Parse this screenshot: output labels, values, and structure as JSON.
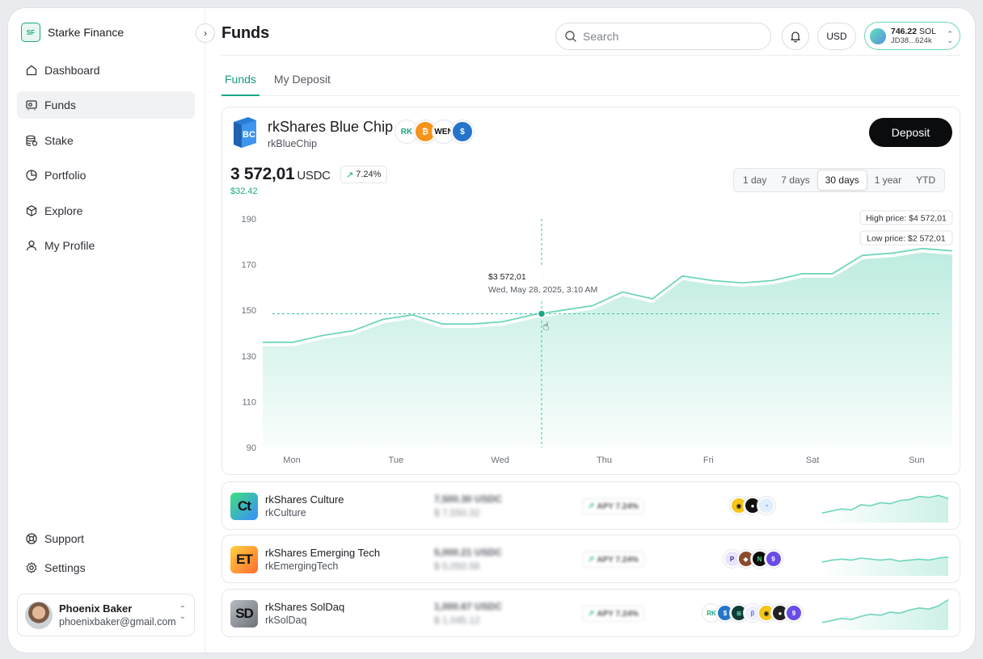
{
  "brand": {
    "name": "Starke Finance",
    "logo_text": "SF"
  },
  "sidebar": {
    "items": [
      {
        "label": "Dashboard",
        "icon": "home-icon"
      },
      {
        "label": "Funds",
        "icon": "funds-icon",
        "active": true
      },
      {
        "label": "Stake",
        "icon": "stake-icon"
      },
      {
        "label": "Portfolio",
        "icon": "portfolio-icon"
      },
      {
        "label": "Explore",
        "icon": "explore-icon"
      },
      {
        "label": "My Profile",
        "icon": "user-icon"
      }
    ],
    "bottom": [
      {
        "label": "Support",
        "icon": "support-icon"
      },
      {
        "label": "Settings",
        "icon": "gear-icon"
      }
    ],
    "user": {
      "name": "Phoenix Baker",
      "email": "phoenixbaker@gmail.com"
    }
  },
  "header": {
    "title": "Funds",
    "search_placeholder": "Search",
    "currency": "USD",
    "wallet": {
      "balance": "746.22",
      "unit": "SOL",
      "address": "JD38...624k"
    }
  },
  "tabs": [
    {
      "label": "Funds",
      "active": true
    },
    {
      "label": "My Deposit"
    }
  ],
  "fund": {
    "name": "rkShares Blue Chip",
    "ticker": "rkBlueChip",
    "logo_text": "BC",
    "deposit_label": "Deposit",
    "price": "3 572,01",
    "price_unit": "USDC",
    "change_pct": "7.24%",
    "change_abs": "$32.42",
    "tokens": [
      {
        "label": "RK",
        "bg": "#ffffff",
        "fg": "#1aa886"
      },
      {
        "label": "₿",
        "bg": "#f7931a",
        "fg": "#ffffff"
      },
      {
        "label": "WEN",
        "bg": "#ffffff",
        "fg": "#111111"
      },
      {
        "label": "$",
        "bg": "#2775ca",
        "fg": "#ffffff"
      }
    ],
    "ranges": [
      {
        "label": "1 day"
      },
      {
        "label": "7 days"
      },
      {
        "label": "30 days",
        "active": true
      },
      {
        "label": "1 year"
      },
      {
        "label": "YTD"
      }
    ]
  },
  "chart_data": {
    "type": "area",
    "x": [
      "Mon",
      "Tue",
      "Wed",
      "Thu",
      "Fri",
      "Sat",
      "Sun"
    ],
    "y_ticks": [
      190,
      170,
      150,
      130,
      110,
      90
    ],
    "ylim": [
      90,
      190
    ],
    "series": [
      {
        "values": [
          136,
          136,
          139,
          141,
          146,
          148,
          144,
          144,
          145,
          148,
          150,
          152,
          158,
          155,
          165,
          163,
          162,
          163,
          166,
          166,
          174,
          175,
          177,
          176
        ]
      }
    ],
    "reference_line": 148.5,
    "high_label": "High price: $4 572,01",
    "low_label": "Low price: $2 572,01",
    "tooltip": {
      "value": "$3 572,01",
      "date": "Wed, May 28, 2025, 3:10 AM"
    },
    "grid": false,
    "color": "#6ed5bc"
  },
  "fund_rows": [
    {
      "name": "rkShares Culture",
      "ticker": "rkCulture",
      "logo_text": "Ct",
      "logo_bg": "linear-gradient(135deg,#3ee07a,#3b8cff)",
      "value": "7,500.30 USDC",
      "value_usd": "$ 7,550.32",
      "apy": "APY 7.24%",
      "tokens": [
        {
          "label": "◉",
          "bg": "#f5c518",
          "fg": "#111"
        },
        {
          "label": "●",
          "bg": "#111111",
          "fg": "#fff"
        },
        {
          "label": "◔",
          "bg": "#dfeffd",
          "fg": "#4a8fd8"
        }
      ],
      "spark": [
        6,
        8,
        10,
        9,
        14,
        13,
        16,
        15,
        18,
        19,
        22,
        21,
        23,
        20
      ]
    },
    {
      "name": "rkShares Emerging Tech",
      "ticker": "rkEmergingTech",
      "logo_text": "ET",
      "logo_bg": "linear-gradient(135deg,#ffd23f,#ff6b2d)",
      "value": "5,000.21 USDC",
      "value_usd": "$ 5,050.56",
      "apy": "APY 7.24%",
      "tokens": [
        {
          "label": "P",
          "bg": "#e8e4ff",
          "fg": "#3b2a8a"
        },
        {
          "label": "◆",
          "bg": "#8a4b2d",
          "fg": "#fff"
        },
        {
          "label": "N",
          "bg": "#0b0b0b",
          "fg": "#3ee07a"
        },
        {
          "label": "9",
          "bg": "#6b4ce6",
          "fg": "#fff"
        }
      ],
      "spark": [
        10,
        12,
        13,
        12,
        14,
        13,
        12,
        13,
        11,
        12,
        13,
        12,
        14,
        15
      ]
    },
    {
      "name": "rkShares SolDaq",
      "ticker": "rkSolDaq",
      "logo_text": "SD",
      "logo_bg": "linear-gradient(135deg,#b8bcc2,#6d7279)",
      "value": "1,000.67 USDC",
      "value_usd": "$ 1,045.12",
      "apy": "APY 7.24%",
      "tokens": [
        {
          "label": "RK",
          "bg": "#ffffff",
          "fg": "#1aa886"
        },
        {
          "label": "$",
          "bg": "#2775ca",
          "fg": "#fff"
        },
        {
          "label": "≋",
          "bg": "#0f3d3a",
          "fg": "#7ef0d0"
        },
        {
          "label": "β",
          "bg": "#eef0ff",
          "fg": "#6b6fd8"
        },
        {
          "label": "◉",
          "bg": "#f5c518",
          "fg": "#111"
        },
        {
          "label": "●",
          "bg": "#222222",
          "fg": "#fff"
        },
        {
          "label": "9",
          "bg": "#6b4ce6",
          "fg": "#fff"
        }
      ],
      "spark": [
        4,
        6,
        8,
        7,
        10,
        12,
        11,
        14,
        13,
        16,
        18,
        17,
        20,
        26
      ]
    }
  ],
  "colors": {
    "accent": "#1aa886",
    "chart_line": "#6ed5bc"
  }
}
